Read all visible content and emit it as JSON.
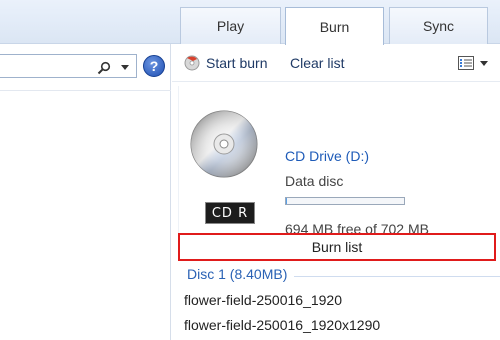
{
  "tabs": [
    {
      "label": "Play"
    },
    {
      "label": "Burn"
    },
    {
      "label": "Sync"
    }
  ],
  "search": {
    "placeholder": ""
  },
  "help": {
    "label": "?"
  },
  "toolbar": {
    "start_burn_label": "Start burn",
    "clear_list_label": "Clear list"
  },
  "drive": {
    "name": "CD Drive (D:)",
    "disc_type": "Data disc",
    "disc_label": "CD R",
    "free_space_text": "694 MB free of 702 MB",
    "used_fraction": 0.011
  },
  "burn_list": {
    "header": "Burn list",
    "group": "Disc 1 (8.40MB)",
    "items": [
      {
        "name": "flower-field-250016_1920"
      },
      {
        "name": "flower-field-250016_1920x1290"
      }
    ]
  },
  "colors": {
    "link_blue": "#1e5bb8",
    "highlight_red": "#e01b1b",
    "tab_bg": "#e4ecf7"
  }
}
